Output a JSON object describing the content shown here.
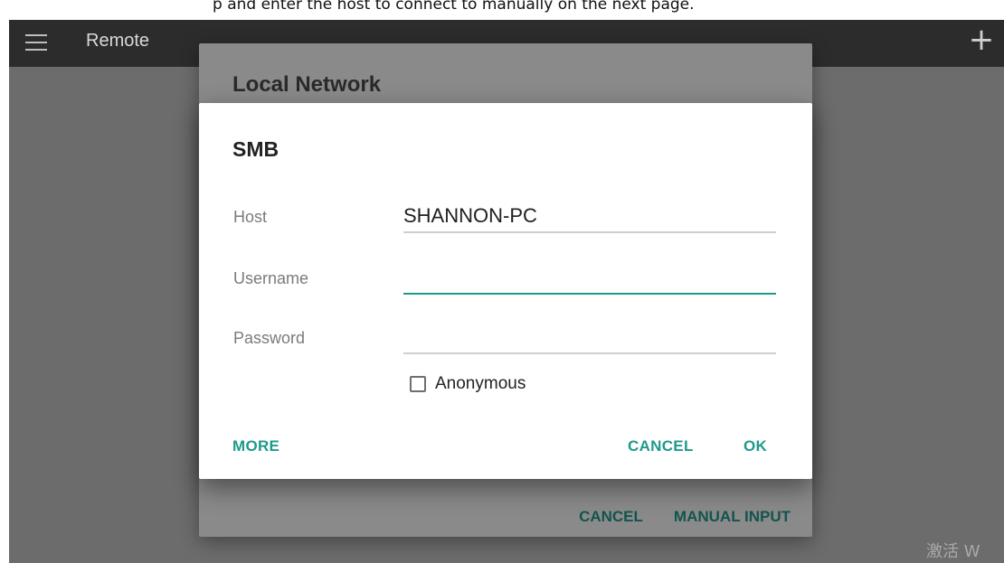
{
  "top_strip": {
    "text": "p and enter the host to connect to manually on the next page."
  },
  "toolbar": {
    "title": "Remote",
    "menu_icon": "hamburger-menu-icon",
    "add_icon": "plus-icon",
    "add_glyph": "+"
  },
  "background_dialog": {
    "title": "Local Network",
    "cancel_label": "CANCEL",
    "manual_input_label": "MANUAL INPUT"
  },
  "dialog": {
    "title": "SMB",
    "host_label": "Host",
    "host_value": "SHANNON-PC",
    "username_label": "Username",
    "username_value": "",
    "password_label": "Password",
    "password_value": "",
    "anonymous_label": "Anonymous",
    "anonymous_checked": false,
    "more_label": "MORE",
    "cancel_label": "CANCEL",
    "ok_label": "OK"
  },
  "watermark": {
    "text": "激活 W"
  },
  "colors": {
    "accent": "#1e9a8c",
    "toolbar": "#2c2c2c",
    "scrim": "#6c6c6c",
    "back_dialog": "#8a8a8a",
    "back_dialog_action": "#14544e"
  }
}
